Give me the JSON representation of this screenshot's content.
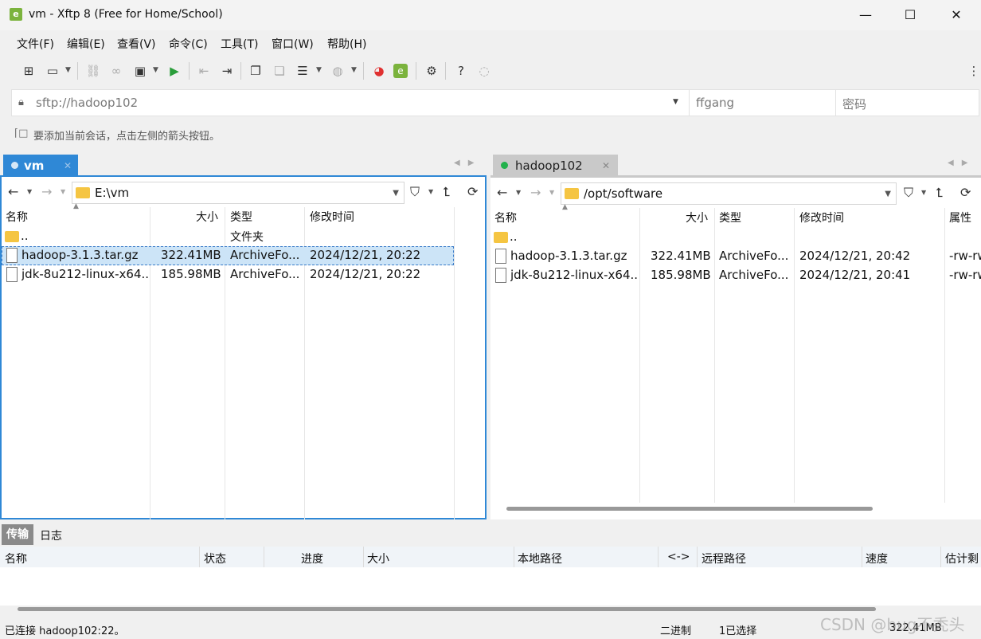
{
  "window": {
    "title": "vm - Xftp 8 (Free for Home/School)",
    "app_icon": "xftp-logo-icon",
    "controls": {
      "minimize": "—",
      "maximize": "☐",
      "close": "✕"
    }
  },
  "menu": [
    "文件(F)",
    "编辑(E)",
    "查看(V)",
    "命令(C)",
    "工具(T)",
    "窗口(W)",
    "帮助(H)"
  ],
  "address": {
    "value": "sftp://hadoop102",
    "user_placeholder": "ffgang",
    "password_placeholder": "密码"
  },
  "hint": "要添加当前会话，点击左侧的箭头按钮。",
  "left": {
    "tab": "vm",
    "path": "E:\\vm",
    "columns": [
      "名称",
      "大小",
      "类型",
      "修改时间"
    ],
    "parent": {
      "name": "..",
      "type": "文件夹"
    },
    "files": [
      {
        "name": "hadoop-3.1.3.tar.gz",
        "size": "322.41MB",
        "type": "ArchiveFo...",
        "mtime": "2024/12/21, 20:22"
      },
      {
        "name": "jdk-8u212-linux-x64...",
        "size": "185.98MB",
        "type": "ArchiveFo...",
        "mtime": "2024/12/21, 20:22"
      }
    ]
  },
  "right": {
    "tab": "hadoop102",
    "path": "/opt/software",
    "columns": [
      "名称",
      "大小",
      "类型",
      "修改时间",
      "属性"
    ],
    "parent": {
      "name": ".."
    },
    "files": [
      {
        "name": "hadoop-3.1.3.tar.gz",
        "size": "322.41MB",
        "type": "ArchiveFo...",
        "mtime": "2024/12/21, 20:42",
        "attr": "-rw-rw"
      },
      {
        "name": "jdk-8u212-linux-x64...",
        "size": "185.98MB",
        "type": "ArchiveFo...",
        "mtime": "2024/12/21, 20:41",
        "attr": "-rw-rw"
      }
    ]
  },
  "transfer": {
    "tabs": [
      "传输",
      "日志"
    ],
    "columns": [
      "名称",
      "状态",
      "进度",
      "大小",
      "本地路径",
      "<->",
      "远程路径",
      "速度",
      "估计剩"
    ]
  },
  "status": {
    "connection": "已连接 hadoop102:22。",
    "mode": "二进制",
    "selection": "1已选择",
    "size": "322.41MB"
  },
  "watermark": "CSDN @bug不秃头",
  "colors": {
    "accent": "#2f88d6",
    "selection": "#cce4f7",
    "connected_dot": "#22b14c"
  }
}
